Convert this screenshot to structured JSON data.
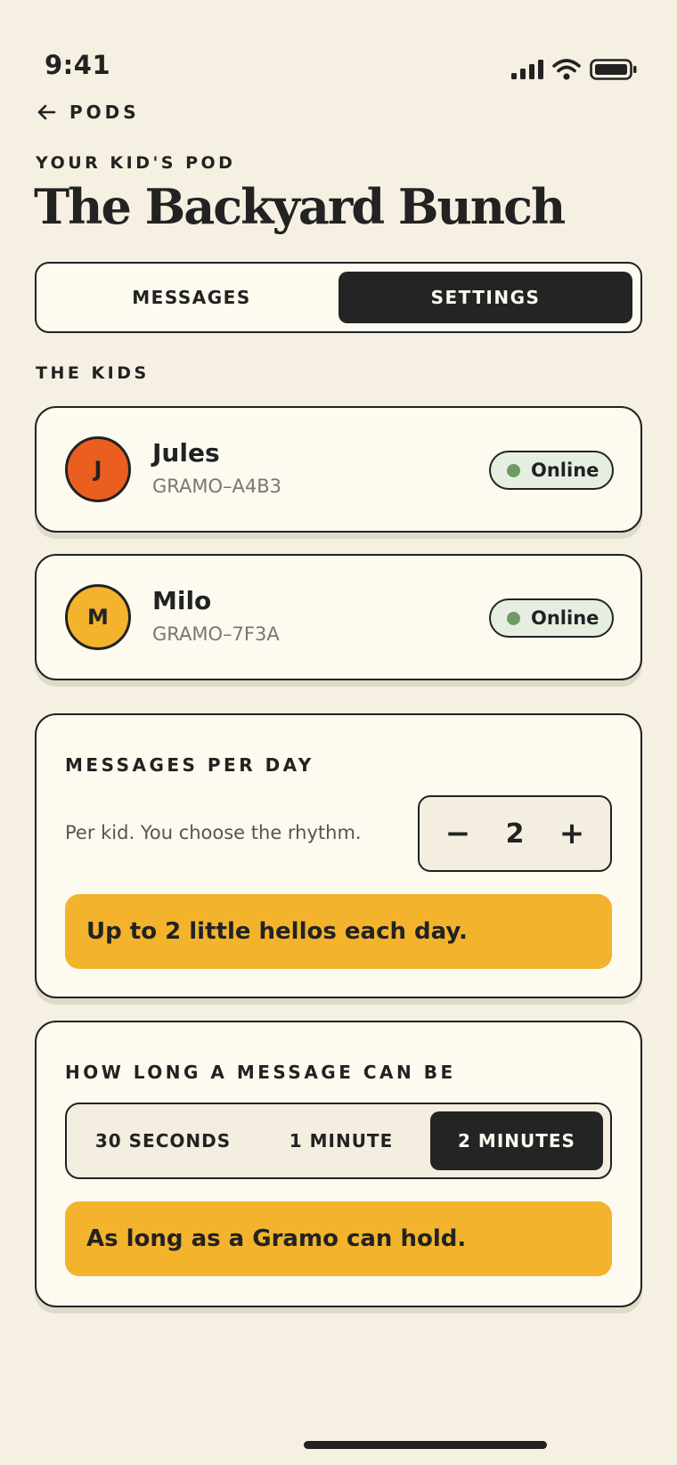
{
  "status_bar": {
    "time": "9:41",
    "icons": [
      "cellular-signal-icon",
      "wifi-icon",
      "battery-icon"
    ]
  },
  "nav": {
    "back_label": "PODS"
  },
  "header": {
    "eyebrow": "YOUR KID'S POD",
    "title": "The Backyard Bunch"
  },
  "tabs": [
    {
      "label": "MESSAGES",
      "active": false
    },
    {
      "label": "SETTINGS",
      "active": true
    }
  ],
  "kids_section": {
    "label": "THE KIDS",
    "kids": [
      {
        "initial": "J",
        "name": "Jules",
        "code": "GRAMO–A4B3",
        "status": "Online",
        "avatar_color": "#ea5e1f"
      },
      {
        "initial": "M",
        "name": "Milo",
        "code": "GRAMO–7F3A",
        "status": "Online",
        "avatar_color": "#f3b32c"
      }
    ]
  },
  "messages_per_day": {
    "label": "MESSAGES PER DAY",
    "hint": "Per kid. You choose the rhythm.",
    "value": "2",
    "decrement": "−",
    "increment": "+",
    "summary": "Up to 2 little hellos each day."
  },
  "message_length": {
    "label": "HOW LONG A MESSAGE CAN BE",
    "options": [
      {
        "label": "30 SECONDS",
        "active": false
      },
      {
        "label": "1 MINUTE",
        "active": false
      },
      {
        "label": "2 MINUTES",
        "active": true
      }
    ],
    "summary": "As long as a Gramo can hold."
  },
  "colors": {
    "background": "#f5f0e2",
    "card": "#fdfaf0",
    "ink": "#222222",
    "accent_yellow": "#f3b32c",
    "accent_orange": "#ea5e1f",
    "online_green": "#6f9a62"
  }
}
